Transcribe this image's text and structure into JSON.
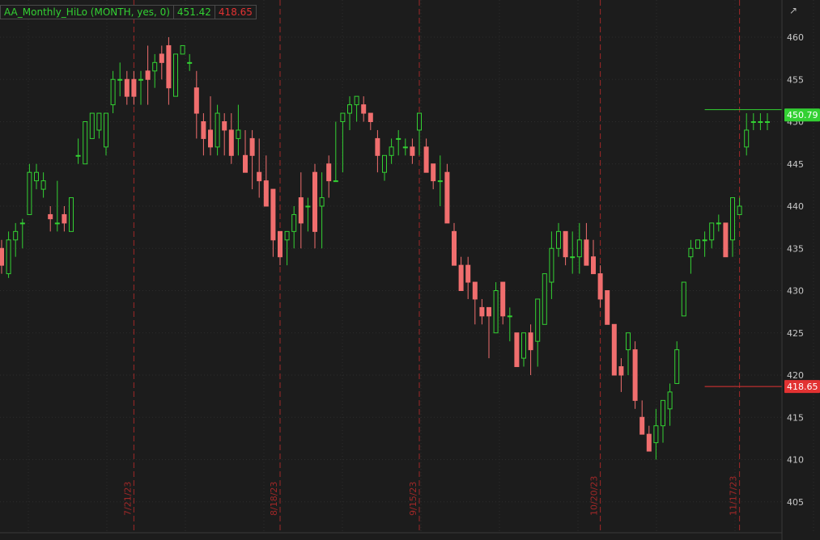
{
  "legend": {
    "study": "AA_Monthly_HiLo (MONTH, yes, 0)",
    "high": "451.42",
    "low": "418.65"
  },
  "colors": {
    "background": "#1c1c1c",
    "up": "#33d133",
    "down": "#f06e6e",
    "grid": "#2c2c2c",
    "period_marker": "#a02828",
    "axis_text": "#c8c8c8"
  },
  "icons": {
    "corner": "expand-icon"
  },
  "chart_data": {
    "type": "candlestick",
    "y_ticks": [
      460,
      455,
      450,
      445,
      440,
      435,
      430,
      425,
      420,
      415,
      410,
      405
    ],
    "ylim": [
      402,
      462
    ],
    "price_labels": [
      {
        "value": 450.79,
        "label": "450.79",
        "color": "#33d133"
      },
      {
        "value": 418.65,
        "label": "418.65",
        "color": "#e23232"
      }
    ],
    "hilo_lines": [
      {
        "name": "high",
        "value": 451.42,
        "color": "#33d133",
        "from_index": 101
      },
      {
        "name": "low",
        "value": 418.65,
        "color": "#e23232",
        "from_index": 101
      }
    ],
    "period_markers": [
      {
        "label": "7/21/23",
        "index": 19
      },
      {
        "label": "8/18/23",
        "index": 40
      },
      {
        "label": "9/15/23",
        "index": 60
      },
      {
        "label": "10/20/23",
        "index": 86
      },
      {
        "label": "11/17/23",
        "index": 106
      }
    ],
    "candles": [
      [
        435,
        436,
        432,
        433
      ],
      [
        432,
        437,
        431.5,
        436
      ],
      [
        436,
        438,
        434,
        437
      ],
      [
        438,
        438.5,
        435,
        438
      ],
      [
        439,
        445,
        439,
        444
      ],
      [
        443,
        445,
        442,
        444
      ],
      [
        442,
        444,
        441,
        443
      ],
      [
        439,
        440,
        437,
        438.5
      ],
      [
        438,
        443,
        437,
        438
      ],
      [
        439,
        440,
        437,
        438
      ],
      [
        437,
        441,
        437,
        441
      ],
      [
        446,
        448,
        445,
        446
      ],
      [
        445,
        450,
        445,
        450
      ],
      [
        448,
        451,
        448,
        451
      ],
      [
        449,
        451,
        448,
        451
      ],
      [
        447,
        451,
        446,
        451
      ],
      [
        452,
        456,
        451,
        455
      ],
      [
        455,
        457,
        453,
        455
      ],
      [
        455,
        456,
        452,
        453
      ],
      [
        455,
        456,
        452,
        453
      ],
      [
        455,
        456,
        452,
        455
      ],
      [
        456,
        459,
        452,
        455
      ],
      [
        456,
        458,
        454,
        457
      ],
      [
        458,
        459,
        455,
        457
      ],
      [
        459,
        460,
        452,
        454
      ],
      [
        453,
        458,
        453,
        458
      ],
      [
        458,
        459,
        458,
        459
      ],
      [
        457,
        458,
        456,
        457
      ],
      [
        454,
        456,
        448,
        451
      ],
      [
        450,
        451,
        446,
        448
      ],
      [
        449,
        453,
        446,
        447
      ],
      [
        447,
        452,
        446,
        451
      ],
      [
        450,
        451,
        446,
        449
      ],
      [
        449,
        451,
        445,
        446
      ],
      [
        448,
        452,
        446,
        449
      ],
      [
        446,
        449,
        444,
        444
      ],
      [
        448,
        449,
        442,
        446
      ],
      [
        444,
        448,
        441,
        443
      ],
      [
        443,
        446,
        440,
        440
      ],
      [
        442,
        442,
        434,
        436
      ],
      [
        437,
        437,
        433,
        434
      ],
      [
        436,
        437,
        433,
        437
      ],
      [
        437,
        440,
        435,
        439
      ],
      [
        441,
        444,
        435,
        438
      ],
      [
        440,
        441,
        437,
        440
      ],
      [
        444,
        445,
        435,
        437
      ],
      [
        440,
        444,
        435,
        441
      ],
      [
        445,
        446,
        441,
        443
      ],
      [
        443,
        450,
        443,
        443
      ],
      [
        450,
        451,
        444,
        451
      ],
      [
        451,
        453,
        449,
        452
      ],
      [
        452,
        453,
        450,
        453
      ],
      [
        452,
        453,
        450,
        451
      ],
      [
        451,
        451,
        449,
        450
      ],
      [
        448,
        449,
        444,
        446
      ],
      [
        444,
        446,
        443,
        446
      ],
      [
        446,
        448,
        445,
        447
      ],
      [
        448,
        449,
        446,
        448
      ],
      [
        447,
        448,
        446,
        447
      ],
      [
        447,
        448,
        445,
        446
      ],
      [
        449,
        451,
        446,
        451
      ],
      [
        447,
        448,
        444,
        444
      ],
      [
        445,
        445,
        442,
        443
      ],
      [
        443,
        446,
        440,
        443
      ],
      [
        444,
        445,
        438,
        438
      ],
      [
        437,
        438,
        433,
        433
      ],
      [
        433,
        434,
        430,
        430
      ],
      [
        433,
        434,
        429,
        431
      ],
      [
        431,
        431,
        426,
        429
      ],
      [
        428,
        429,
        426,
        427
      ],
      [
        428,
        428,
        422,
        427
      ],
      [
        425,
        431,
        425,
        430
      ],
      [
        431,
        431,
        426,
        427
      ],
      [
        427,
        428,
        424,
        427
      ],
      [
        425,
        425,
        421,
        421
      ],
      [
        422,
        425,
        421,
        425
      ],
      [
        425,
        426,
        420,
        423
      ],
      [
        424,
        429,
        421,
        429
      ],
      [
        426,
        432,
        426,
        432
      ],
      [
        431,
        437,
        429,
        435
      ],
      [
        435,
        438,
        434,
        437
      ],
      [
        437,
        437,
        433,
        434
      ],
      [
        434,
        437,
        432,
        434
      ],
      [
        434,
        438,
        432,
        436
      ],
      [
        436,
        438,
        434,
        433
      ],
      [
        434,
        436,
        432,
        432
      ],
      [
        432,
        433,
        428,
        429
      ],
      [
        430,
        430,
        426,
        426
      ],
      [
        426,
        426,
        420,
        420
      ],
      [
        421,
        422,
        418,
        420
      ],
      [
        423,
        425,
        420,
        425
      ],
      [
        423,
        424,
        416,
        417
      ],
      [
        415,
        417,
        413,
        413
      ],
      [
        413,
        414,
        411,
        411
      ],
      [
        412,
        416,
        410,
        414
      ],
      [
        414,
        417,
        412,
        417
      ],
      [
        416,
        419,
        414,
        418
      ],
      [
        419,
        424,
        419,
        423
      ],
      [
        427,
        431,
        427,
        431
      ],
      [
        434,
        436,
        432,
        435
      ],
      [
        435,
        436,
        435,
        436
      ],
      [
        436,
        437,
        434,
        436
      ],
      [
        436,
        438,
        435,
        438
      ],
      [
        438,
        439,
        437,
        438
      ],
      [
        438,
        438,
        434,
        434
      ],
      [
        436,
        441,
        434,
        441
      ],
      [
        439,
        441,
        439,
        440
      ],
      [
        447,
        451,
        446,
        449
      ],
      [
        450,
        451,
        449,
        450
      ],
      [
        450,
        451,
        449,
        450
      ],
      [
        450,
        451,
        449,
        450
      ]
    ]
  }
}
